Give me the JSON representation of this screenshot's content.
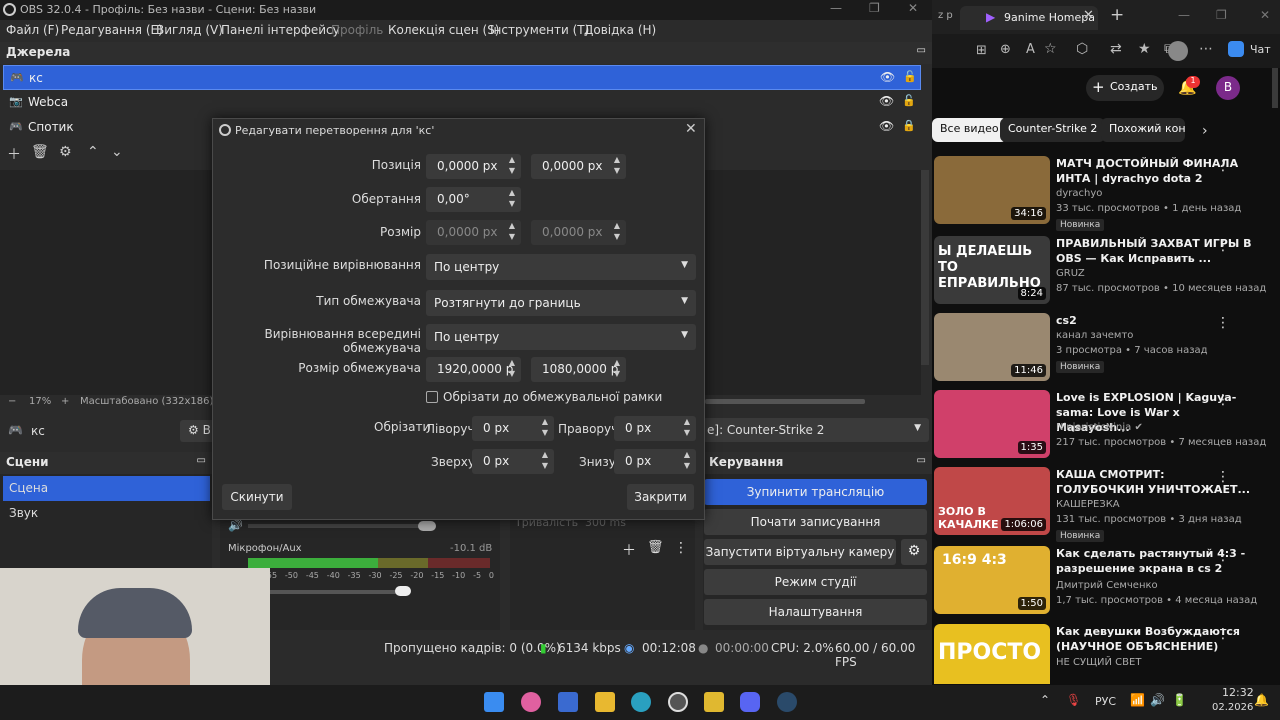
{
  "obs": {
    "title": "OBS 32.0.4 - Профіль: Без назви - Сцени: Без назви",
    "menu": [
      "Файл (F)",
      "Редагування (E)",
      "Вигляд (V)",
      "Панелі інтерфейсу",
      "Профіль",
      "Колекція сцен (S)",
      "Інструменти (T)",
      "Довідка (H)"
    ],
    "sources_header": "Джерела",
    "sources": [
      {
        "name": "кс",
        "icon": "gamepad-icon"
      },
      {
        "name": "Webca",
        "icon": "camera-icon"
      },
      {
        "name": "Спотик",
        "icon": "gamepad-icon"
      }
    ],
    "zoom": "17%",
    "scaled": "Масштабовано (332x186)",
    "selected_source": "кс",
    "scenes_header": "Сцени",
    "scenes": [
      "Сцена",
      "Звук"
    ],
    "window_field": "е]: Counter-Strike 2",
    "controls_header": "Керування",
    "controls": [
      "Зупинити трансляцію",
      "Почати записування",
      "Запустити віртуальну камеру",
      "Режим студії",
      "Налаштування"
    ],
    "mixer_label": "Мікрофон/Aux",
    "mixer_db": "-10.1 dB",
    "duration_label": "Тривалість",
    "duration_value": "300 ms",
    "meter_ticks": [
      "-55",
      "-50",
      "-45",
      "-40",
      "-35",
      "-30",
      "-25",
      "-20",
      "-15",
      "-10",
      "-5",
      "0"
    ],
    "status": {
      "dropped": "Пропущено кадрів: 0 (0.0%)",
      "kbps": "6134 kbps",
      "stream_time": "00:12:08",
      "rec_time": "00:00:00",
      "cpu": "CPU: 2.0%",
      "fps": "60.00 / 60.00 FPS"
    }
  },
  "dialog": {
    "title": "Редагувати перетворення для 'кс'",
    "position_label": "Позиція",
    "pos_x": "0,0000 px",
    "pos_y": "0,0000 px",
    "rotation_label": "Обертання",
    "rotation": "0,00°",
    "size_label": "Розмір",
    "size_w": "0,0000 px",
    "size_h": "0,0000 px",
    "align_label": "Позиційне вирівнювання",
    "align": "По центру",
    "bbox_type_label": "Тип обмежувача",
    "bbox_type": "Розтягнути до границь",
    "bbox_align_label": "Вирівнювання всередині обмежувача",
    "bbox_align": "По центру",
    "bbox_size_label": "Розмір обмежувача",
    "bbox_w": "1920,0000 p",
    "bbox_h": "1080,0000 p",
    "crop_bbox_label": "Обрізати до обмежувальної рамки",
    "crop_label": "Обрізати",
    "left_label": "Ліворуч",
    "left": "0 px",
    "right_label": "Праворуч",
    "right": "0 px",
    "top_label": "Зверху",
    "top": "0 px",
    "bottom_label": "Знизу",
    "bottom": "0 px",
    "reset_label": "Скинути",
    "close_label": "Закрити"
  },
  "browser": {
    "tab_prefix": "z p",
    "tab_title": "9anime Homepa",
    "create_label": "Создать",
    "notif_count": "1",
    "avatar": "B",
    "chat_label": "Чат",
    "chips": [
      "Все видео",
      "Counter-Strike 2",
      "Похожий конте"
    ],
    "videos": [
      {
        "title": "МАТЧ ДОСТОЙНЫЙ ФИНАЛА ИНТА | dyrachyo dota 2",
        "channel": "dyrachyo",
        "meta": "33 тыс. просмотров • 1 день назад",
        "badge": "Новинка",
        "dur": "34:16",
        "color": "#8a6a3a"
      },
      {
        "title": "ПРАВИЛЬНЫЙ ЗАХВАТ ИГРЫ В OBS — Как Исправить ...",
        "channel": "GRUZ",
        "meta": "87 тыс. просмотров • 10 месяцев назад",
        "badge": "",
        "dur": "8:24",
        "color": "#3a3a3a",
        "thumb_text": "Ы ДЕЛАЕШЬ ТО ЕПРАВИЛЬНО"
      },
      {
        "title": "cs2",
        "channel": "канал зачемто",
        "meta": "3 просмотра • 7 часов назад",
        "badge": "Новинка",
        "dur": "11:46",
        "color": "#9a8870"
      },
      {
        "title": "Love is EXPLOSION | Kaguya-sama: Love is War x Masayosh...",
        "channel": "NinjaristicNinja ✔",
        "meta": "217 тыс. просмотров • 7 месяцев назад",
        "badge": "",
        "dur": "1:35",
        "color": "#d0406a"
      },
      {
        "title": "КАША СМОТРИТ: ГОЛУБОЧКИН УНИЧТОЖАЕТ...",
        "channel": "КАШЕРЕЗКА",
        "meta": "131 тыс. просмотров • 3 дня назад",
        "badge": "Новинка",
        "dur": "1:06:06",
        "color": "#c04848",
        "thumb_text": "ЗОЛО В КАЧАЛКЕ"
      },
      {
        "title": "Как сделать растянутый 4:3 - разрешение экрана в cs 2",
        "channel": "Дмитрий Семченко",
        "meta": "1,7 тыс. просмотров • 4 месяца назад",
        "badge": "",
        "dur": "1:50",
        "color": "#e0b030",
        "thumb_text": "16:9 4:3"
      },
      {
        "title": "Как девушки Возбуждаются (НАУЧНОЕ ОБЪЯСНЕНИЕ)",
        "channel": "НЕ СУЩИЙ СВЕТ",
        "meta": "",
        "badge": "",
        "dur": "",
        "color": "#e8c020",
        "thumb_text": "ПРОСТО"
      }
    ]
  },
  "taskbar": {
    "lang": "РУС",
    "time": "12:32",
    "date": "02.2026"
  }
}
